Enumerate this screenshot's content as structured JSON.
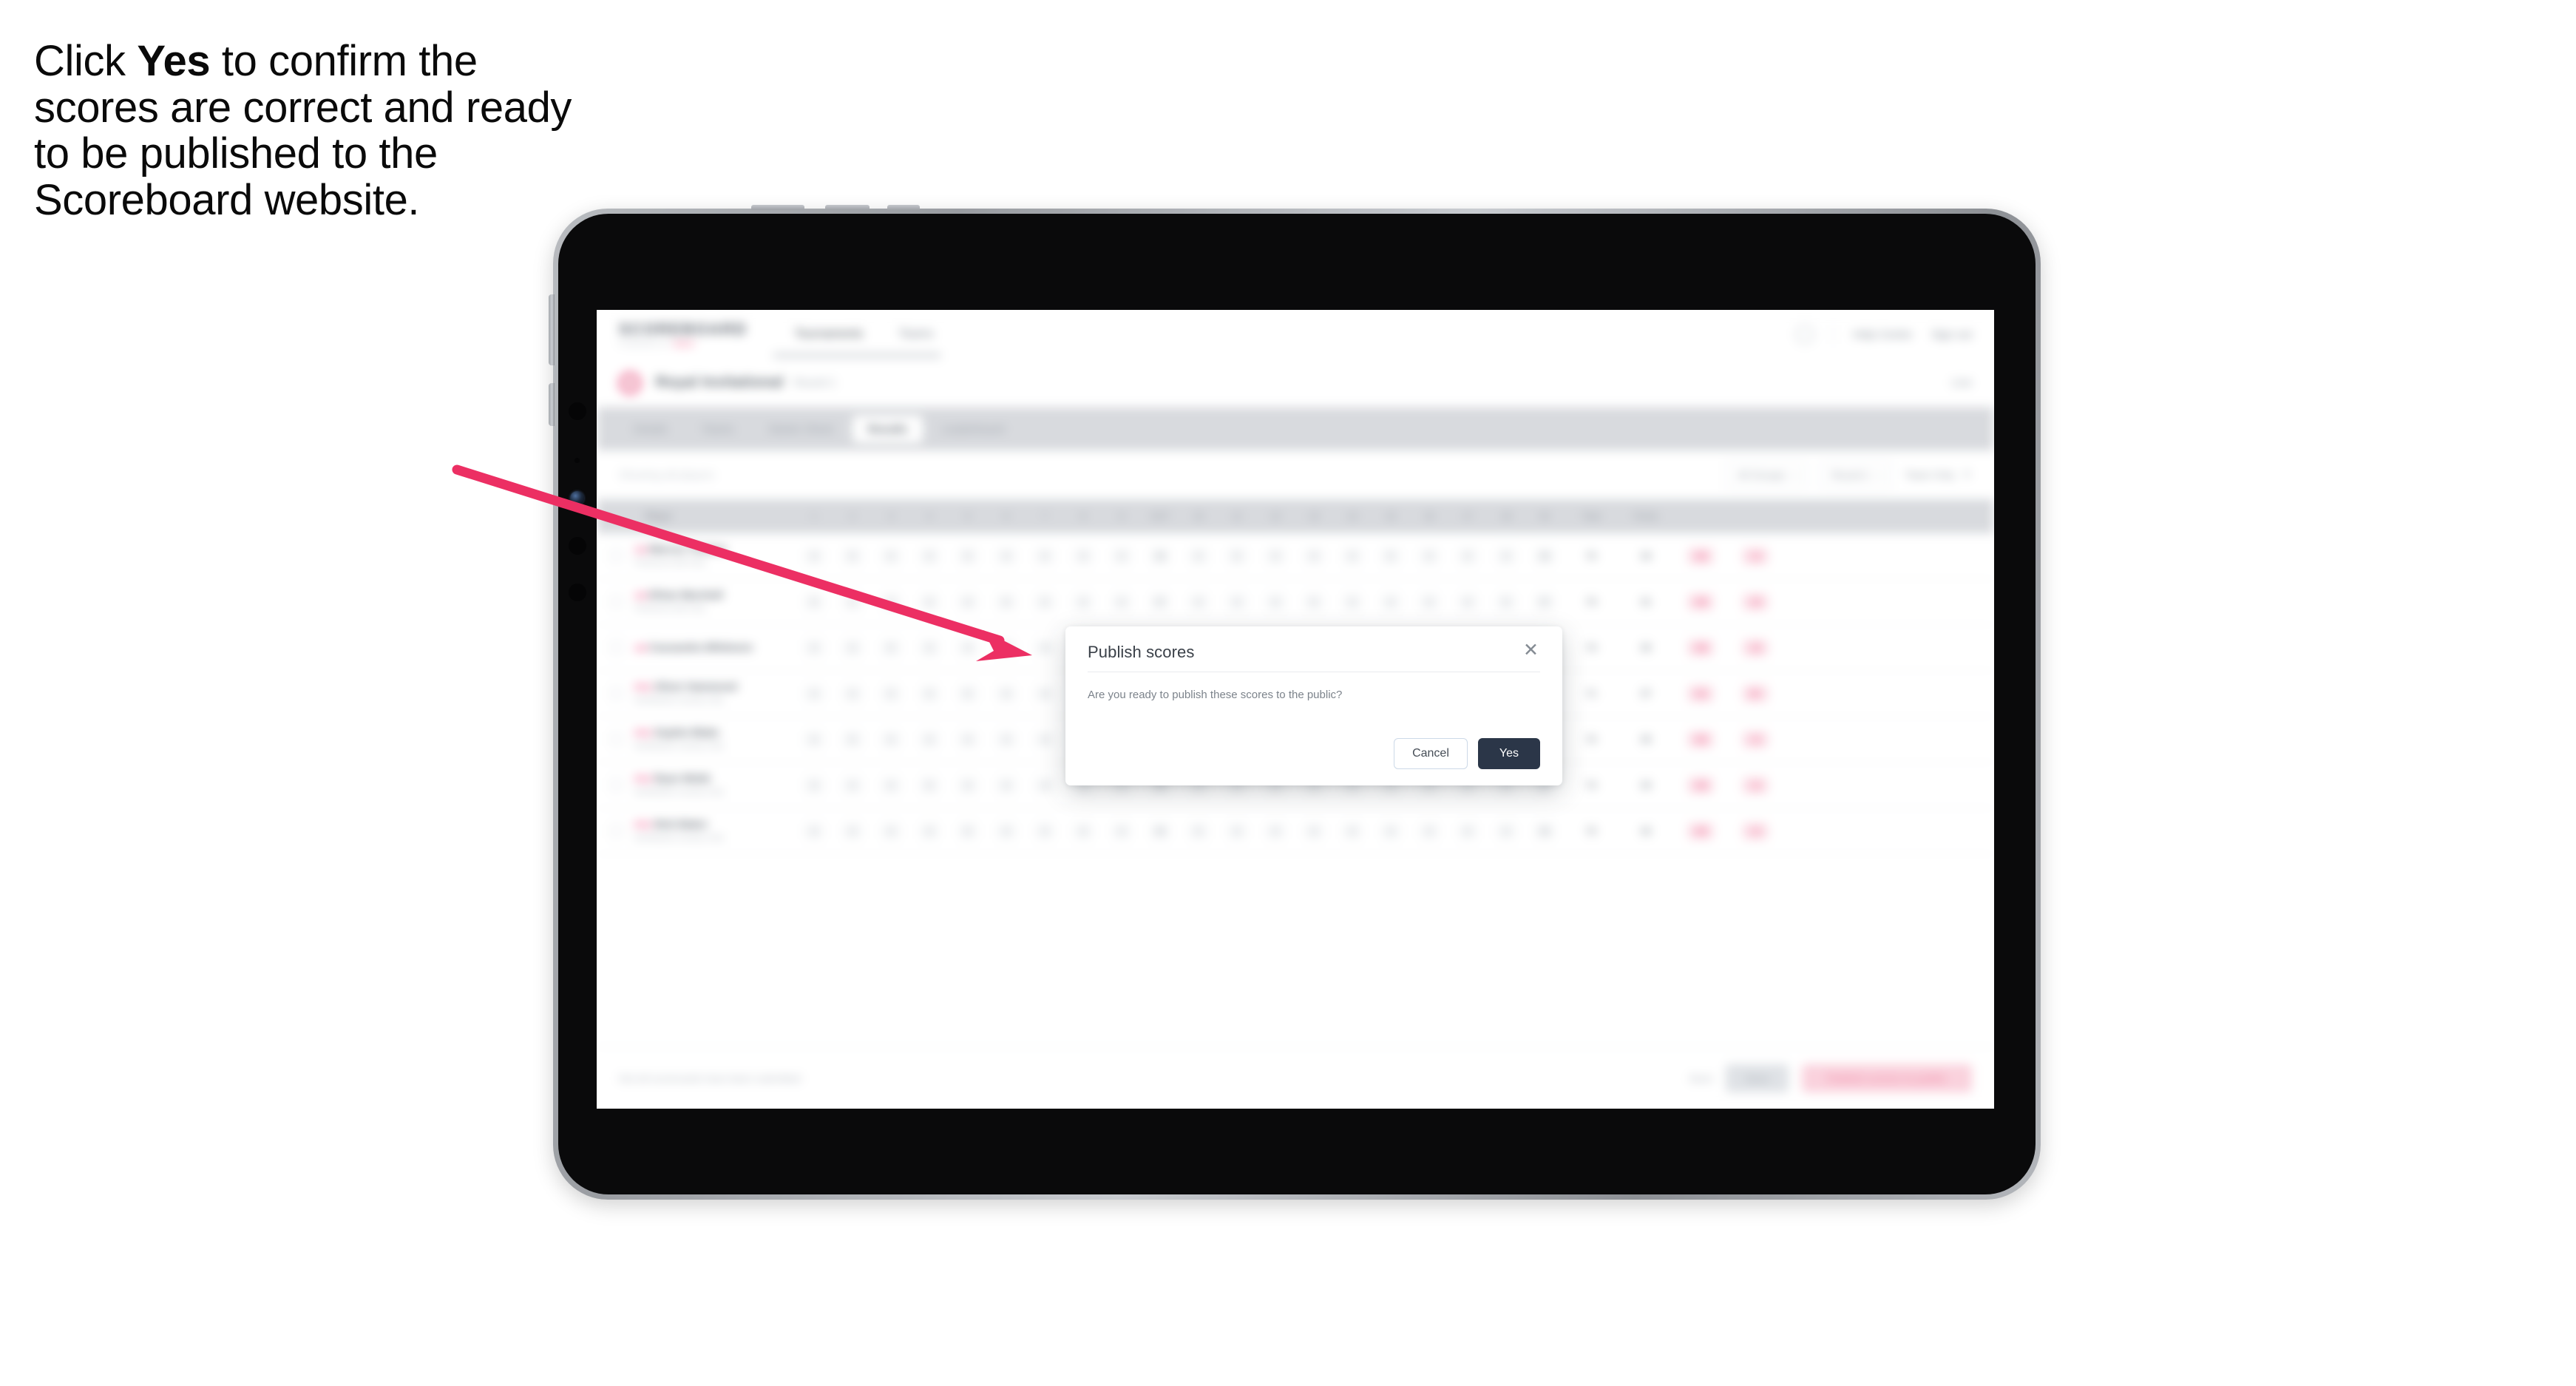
{
  "caption": {
    "before": "Click ",
    "emphasis": "Yes",
    "after": " to confirm the scores are correct and ready to be published to the Scoreboard website."
  },
  "colors": {
    "arrow": "#ec2f63",
    "accent_pink": "#ef4a7d",
    "primary_dark": "#2b3648",
    "tab_strip": "#d8dade"
  },
  "device": {
    "type": "tablet",
    "orientation": "landscape"
  },
  "app": {
    "brand": {
      "name": "SCOREBOARD",
      "tagline_before": "POWERED BY ",
      "tagline_accent": "GOLF"
    },
    "topnav": [
      {
        "label": "Tournaments",
        "active": true
      },
      {
        "label": "Teams",
        "active": false
      }
    ],
    "top_right": [
      {
        "label": "Help Centre"
      },
      {
        "label": "Sign out"
      }
    ],
    "event": {
      "title": "Royal Invitational",
      "subtitle": "Round 1",
      "status": "Live"
    },
    "tabs": [
      {
        "label": "Details",
        "active": false
      },
      {
        "label": "Teams",
        "active": false
      },
      {
        "label": "Starter Sheet",
        "active": false
      },
      {
        "label": "Results",
        "active": true
      },
      {
        "label": "Leaderboard",
        "active": false
      }
    ],
    "filters": {
      "left_label": "Showing all players",
      "group_select": "All Groups",
      "round_select": "Round 1",
      "display_link": "Team Only",
      "clear_icon": "close-icon"
    },
    "table": {
      "columns": [
        {
          "label": "Player",
          "kind": "player"
        },
        {
          "label": "1",
          "kind": "hole"
        },
        {
          "label": "2",
          "kind": "hole"
        },
        {
          "label": "3",
          "kind": "hole"
        },
        {
          "label": "4",
          "kind": "hole"
        },
        {
          "label": "5",
          "kind": "hole"
        },
        {
          "label": "6",
          "kind": "hole"
        },
        {
          "label": "7",
          "kind": "hole"
        },
        {
          "label": "8",
          "kind": "hole"
        },
        {
          "label": "9",
          "kind": "hole"
        },
        {
          "label": "OUT",
          "kind": "hole"
        },
        {
          "label": "10",
          "kind": "hole"
        },
        {
          "label": "11",
          "kind": "hole"
        },
        {
          "label": "12",
          "kind": "hole"
        },
        {
          "label": "13",
          "kind": "hole"
        },
        {
          "label": "14",
          "kind": "hole"
        },
        {
          "label": "15",
          "kind": "hole"
        },
        {
          "label": "16",
          "kind": "hole"
        },
        {
          "label": "17",
          "kind": "hole"
        },
        {
          "label": "18",
          "kind": "hole"
        },
        {
          "label": "IN",
          "kind": "hole"
        },
        {
          "label": "Total",
          "kind": "wide"
        },
        {
          "label": "Points",
          "kind": "wide"
        }
      ],
      "rows": [
        {
          "badge": "AM",
          "name": "Marcus Trenton",
          "sub": "Pinehurst Golf Club",
          "holes": [
            "4",
            "5",
            "4",
            "3",
            "5",
            "4",
            "4",
            "3",
            "4",
            "36",
            "4",
            "5",
            "3",
            "4",
            "4",
            "5",
            "3",
            "4",
            "4",
            "36"
          ],
          "total": "72",
          "points": "34",
          "chips": [
            "+2",
            "-1"
          ]
        },
        {
          "badge": "AM",
          "name": "Ethan Marshall",
          "sub": "Pinehurst Golf Club",
          "holes": [
            "5",
            "4",
            "4",
            "4",
            "4",
            "5",
            "3",
            "4",
            "4",
            "37",
            "4",
            "4",
            "4",
            "5",
            "3",
            "4",
            "4",
            "4",
            "5",
            "37"
          ],
          "total": "74",
          "points": "31",
          "chips": [
            "+4",
            "-2"
          ]
        },
        {
          "badge": "AM",
          "name": "Cassandra Whitmore",
          "sub": "",
          "holes": [
            "4",
            "4",
            "5",
            "3",
            "4",
            "4",
            "4",
            "4",
            "5",
            "37",
            "5",
            "4",
            "3",
            "4",
            "4",
            "4",
            "4",
            "5",
            "4",
            "37"
          ],
          "total": "74",
          "points": "30",
          "chips": [
            "+4",
            "-2"
          ]
        },
        {
          "badge": "PRO",
          "name": "Oliver Hammond",
          "sub": "Northlands Country Club",
          "holes": [
            "4",
            "4",
            "3",
            "4",
            "5",
            "4",
            "4",
            "3",
            "4",
            "35",
            "4",
            "4",
            "4",
            "4",
            "3",
            "5",
            "4",
            "4",
            "4",
            "36"
          ],
          "total": "71",
          "points": "37",
          "chips": [
            "+1",
            "E"
          ]
        },
        {
          "badge": "PRO",
          "name": "Sophie Blake",
          "sub": "Northlands Country Club",
          "holes": [
            "4",
            "5",
            "4",
            "4",
            "4",
            "3",
            "4",
            "4",
            "4",
            "36",
            "4",
            "3",
            "4",
            "5",
            "4",
            "4",
            "4",
            "4",
            "4",
            "36"
          ],
          "total": "72",
          "points": "35",
          "chips": [
            "+2",
            "-1"
          ]
        },
        {
          "badge": "PRO",
          "name": "Ryan Webb",
          "sub": "Northlands Country Club",
          "holes": [
            "3",
            "4",
            "4",
            "5",
            "4",
            "4",
            "4",
            "4",
            "4",
            "36",
            "4",
            "4",
            "5",
            "4",
            "4",
            "3",
            "4",
            "4",
            "5",
            "37"
          ],
          "total": "73",
          "points": "33",
          "chips": [
            "+3",
            "-1"
          ]
        },
        {
          "badge": "PRO",
          "name": "Nick Baker",
          "sub": "Northlands Country Club",
          "holes": [
            "4",
            "4",
            "4",
            "4",
            "5",
            "4",
            "3",
            "4",
            "4",
            "36",
            "5",
            "4",
            "4",
            "4",
            "4",
            "4",
            "3",
            "4",
            "4",
            "36"
          ],
          "total": "72",
          "points": "32",
          "chips": [
            "+2",
            "-1"
          ]
        }
      ]
    },
    "action_bar": {
      "left_note": "Not all scorecards have been submitted",
      "link": "Back",
      "secondary_button": "Save",
      "primary_button": "Publish scores to public"
    }
  },
  "modal": {
    "title": "Publish scores",
    "close_icon": "close-icon",
    "body": "Are you ready to publish these scores to the public?",
    "cancel_label": "Cancel",
    "confirm_label": "Yes"
  }
}
